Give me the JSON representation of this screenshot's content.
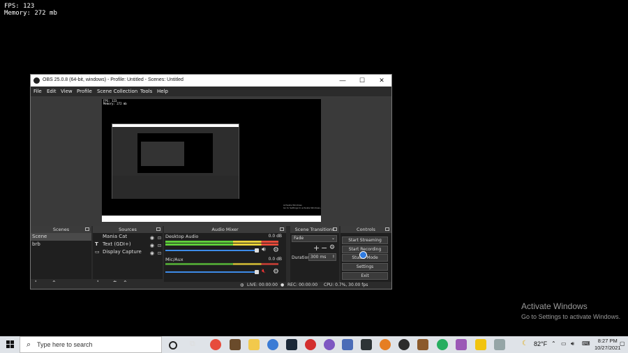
{
  "overlay": {
    "fps": "FPS: 123",
    "memory": "Memory: 272 mb"
  },
  "window": {
    "title": "OBS 25.0.8 (64-bit, windows) - Profile: Untitled - Scenes: Untitled",
    "minimize": "—",
    "maximize": "☐",
    "close": "✕"
  },
  "menu": [
    "File",
    "Edit",
    "View",
    "Profile",
    "Scene Collection",
    "Tools",
    "Help"
  ],
  "preview": {
    "fps": "FPS: 123",
    "memory": "Memory: 272 mb",
    "activate_line1": "Activate Windows",
    "activate_line2": "Go to Settings to activate Windows."
  },
  "scenes": {
    "header": "Scenes",
    "items": [
      "Scene",
      "brb"
    ]
  },
  "sources": {
    "header": "Sources",
    "items": [
      "Mania Cat",
      "Text (GDI+)",
      "Display Capture"
    ]
  },
  "mixer": {
    "header": "Audio Mixer",
    "channels": [
      {
        "name": "Desktop Audio",
        "db": "0.0 dB",
        "level": 1.0,
        "muted": false
      },
      {
        "name": "Mic/Aux",
        "db": "0.0 dB",
        "level": 1.0,
        "muted": true
      }
    ]
  },
  "transitions": {
    "header": "Scene Transitions",
    "type": "Fade",
    "duration_label": "Duration",
    "duration_value": "300 ms"
  },
  "controls": {
    "header": "Controls",
    "buttons": [
      "Start Streaming",
      "Start Recording",
      "Studio Mode",
      "Settings",
      "Exit"
    ]
  },
  "status": {
    "live": "LIVE: 00:00:00",
    "rec": "REC: 00:00:00",
    "cpu": "CPU: 0.7%, 30.00 fps"
  },
  "activate": {
    "line1": "Activate Windows",
    "line2": "Go to Settings to activate Windows."
  },
  "taskbar": {
    "search_placeholder": "Type here to search",
    "weather": "82°F",
    "time": "8:27 PM",
    "date": "10/27/2021",
    "colors": {
      "obs_bg": "#3a3a3a",
      "dock_bg": "#1f1f1f",
      "accent": "#3d8be8",
      "taskbar": "#dfe3e8"
    }
  }
}
